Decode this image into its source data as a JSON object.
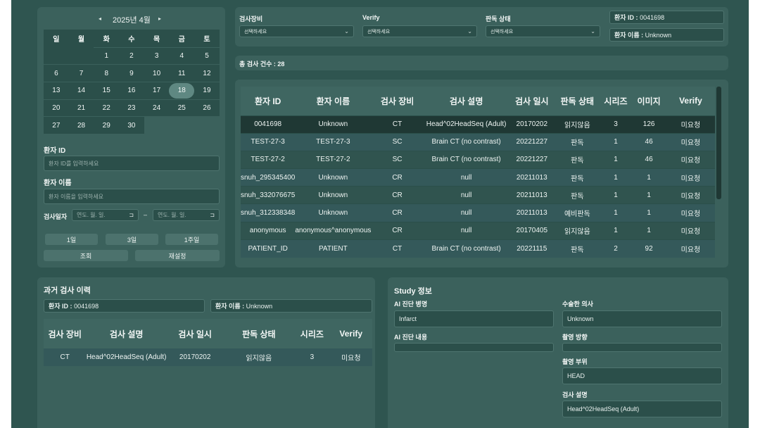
{
  "calendar": {
    "prev": "◂",
    "next": "▸",
    "title": "2025년 4월",
    "weekdays": [
      "일",
      "월",
      "화",
      "수",
      "목",
      "금",
      "토"
    ],
    "weeks": [
      [
        "",
        "",
        "1",
        "2",
        "3",
        "4",
        "5"
      ],
      [
        "6",
        "7",
        "8",
        "9",
        "10",
        "11",
        "12"
      ],
      [
        "13",
        "14",
        "15",
        "16",
        "17",
        "18",
        "19"
      ],
      [
        "20",
        "21",
        "22",
        "23",
        "24",
        "25",
        "26"
      ],
      [
        "27",
        "28",
        "29",
        "30",
        "",
        "",
        ""
      ]
    ],
    "selected": "18"
  },
  "search": {
    "patient_id_label": "환자 ID",
    "patient_id_placeholder": "환자 ID를 입력하세요",
    "patient_name_label": "환자 이름",
    "patient_name_placeholder": "환자 이름을 입력하세요",
    "date_label": "검사일자",
    "date_from": "연도. 월. 일.",
    "date_to": "연도. 월. 일.",
    "date_sep": "–",
    "quick": [
      "1일",
      "3일",
      "1주일"
    ],
    "search_button": "조회",
    "reset_button": "재설정"
  },
  "filters": {
    "device_label": "검사장비",
    "device_value": "선택하세요",
    "verify_label": "Verify",
    "verify_value": "선택하세요",
    "status_label": "판독 상태",
    "status_value": "선택하세요",
    "patient_id_label": "환자 ID :",
    "patient_id_value": "0041698",
    "patient_name_label": "환자 이름 :",
    "patient_name_value": "Unknown"
  },
  "total": "총 검사 건수 : 28",
  "study_table": {
    "columns": [
      "환자 ID",
      "환자 이름",
      "검사 장비",
      "검사 설명",
      "검사 일시",
      "판독 상태",
      "시리즈",
      "이미지",
      "Verify"
    ],
    "rows": [
      [
        "0041698",
        "Unknown",
        "CT",
        "Head^02HeadSeq (Adult)",
        "20170202",
        "읽지않음",
        "3",
        "126",
        "미요청"
      ],
      [
        "TEST-27-3",
        "TEST-27-3",
        "SC",
        "Brain CT (no contrast)",
        "20221227",
        "판독",
        "1",
        "46",
        "미요청"
      ],
      [
        "TEST-27-2",
        "TEST-27-2",
        "SC",
        "Brain CT (no contrast)",
        "20221227",
        "판독",
        "1",
        "46",
        "미요청"
      ],
      [
        "snuh_295345400",
        "Unknown",
        "CR",
        "null",
        "20211013",
        "판독",
        "1",
        "1",
        "미요청"
      ],
      [
        "snuh_332076675",
        "Unknown",
        "CR",
        "null",
        "20211013",
        "판독",
        "1",
        "1",
        "미요청"
      ],
      [
        "snuh_312338348",
        "Unknown",
        "CR",
        "null",
        "20211013",
        "예비판독",
        "1",
        "1",
        "미요청"
      ],
      [
        "anonymous",
        "anonymous^anonymous",
        "CR",
        "null",
        "20170405",
        "읽지않음",
        "1",
        "1",
        "미요청"
      ],
      [
        "PATIENT_ID",
        "PATIENT",
        "CT",
        "Brain CT (no contrast)",
        "20221115",
        "판독",
        "2",
        "92",
        "미요청"
      ]
    ]
  },
  "history": {
    "title": "과거 검사 이력",
    "patient_id_label": "환자 ID :",
    "patient_id_value": "0041698",
    "patient_name_label": "환자 이름 :",
    "patient_name_value": "Unknown",
    "columns": [
      "검사 장비",
      "검사 설명",
      "검사 일시",
      "판독 상태",
      "시리즈",
      "Verify"
    ],
    "rows": [
      [
        "CT",
        "Head^02HeadSeq (Adult)",
        "20170202",
        "읽지않음",
        "3",
        "미요청"
      ]
    ]
  },
  "study_info": {
    "title": "Study 정보",
    "ai_lesion_label": "AI 진단 병명",
    "ai_lesion_value": "Infarct",
    "ai_content_label": "AI 진단 내용",
    "ai_content_value": "",
    "doctor_label": "수술한 의사",
    "doctor_value": "Unknown",
    "direction_label": "촬영 방향",
    "direction_value": "",
    "part_label": "촬영 부위",
    "part_value": "HEAD",
    "desc_label": "검사 설명",
    "desc_value": "Head^02HeadSeq (Adult)"
  },
  "colors": {
    "app_bg": "#2f5550",
    "panel_bg": "#3b615c",
    "field_bg": "#2b4f4a",
    "selected_row": "#1f3834",
    "accent": "#5f8882"
  }
}
